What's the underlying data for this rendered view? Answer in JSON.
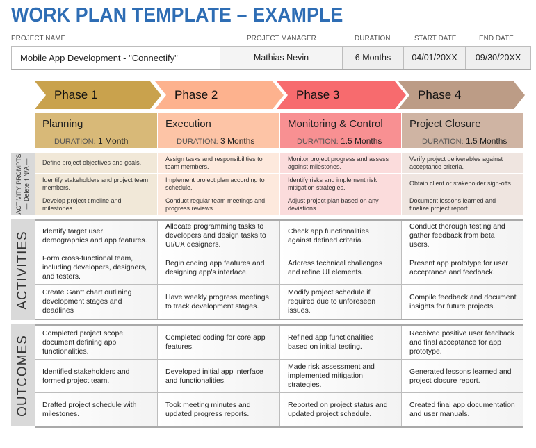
{
  "title": "WORK PLAN TEMPLATE – EXAMPLE",
  "project": {
    "labels": {
      "name": "PROJECT NAME",
      "manager": "PROJECT MANAGER",
      "duration": "DURATION",
      "start": "START DATE",
      "end": "END DATE"
    },
    "name": "Mobile App Development - \"Connectify\"",
    "manager": "Mathias Nevin",
    "duration": "6 Months",
    "start": "04/01/20XX",
    "end": "09/30/20XX"
  },
  "phases": [
    {
      "label": "Phase 1",
      "name": "Planning",
      "duration": "1 Month",
      "chevron_color": "#C9A24D",
      "box_color": "#D8B978"
    },
    {
      "label": "Phase 2",
      "name": "Execution",
      "duration": "3 Months",
      "chevron_color": "#FDB28E",
      "box_color": "#FDC4A6"
    },
    {
      "label": "Phase 3",
      "name": "Monitoring & Control",
      "duration": "1.5 Months",
      "chevron_color": "#F76B6E",
      "box_color": "#F89092"
    },
    {
      "label": "Phase 4",
      "name": "Project Closure",
      "duration": "1.5 Months",
      "chevron_color": "#BC9C86",
      "box_color": "#CFB4A3"
    }
  ],
  "duration_label": "DURATION:",
  "sections": {
    "prompts_label_line1": "ACTIVITY PROMPTS",
    "prompts_label_line2": "— Delete if N/A —",
    "activities_label": "ACTIVITIES",
    "outcomes_label": "OUTCOMES"
  },
  "prompts": [
    [
      "Define project objectives and goals.",
      "Assign tasks and responsibilities to team members.",
      "Monitor project progress and assess against milestones.",
      "Verify project deliverables against acceptance criteria."
    ],
    [
      "Identify stakeholders and project team members.",
      "Implement project plan according to schedule.",
      "Identify risks and implement risk mitigation strategies.",
      "Obtain client or stakeholder sign-offs."
    ],
    [
      "Develop project timeline and milestones.",
      "Conduct regular team meetings and progress reviews.",
      "Adjust project plan based on any deviations.",
      "Document lessons learned and finalize project report."
    ]
  ],
  "activities": [
    [
      "Identify target user demographics and app features.",
      "Allocate programming tasks to developers and design tasks to UI/UX designers.",
      "Check app functionalities against  defined criteria.",
      "Conduct thorough testing and gather feedback from beta users."
    ],
    [
      "Form cross-functional team, including developers, designers, and testers.",
      "Begin coding app features and designing app's interface.",
      "Address technical challenges and refine UI elements.",
      "Present app prototype for user acceptance and feedback."
    ],
    [
      "Create Gantt chart outlining development stages and deadlines",
      "Have weekly progress meetings to track development stages.",
      "Modify project schedule if required due to unforeseen issues.",
      "Compile feedback and document insights for future projects."
    ]
  ],
  "outcomes": [
    [
      "Completed project scope document defining app functionalities.",
      "Completed coding for core app features.",
      "Refined app functionalities based on initial testing.",
      "Received positive user feedback and final acceptance for app prototype."
    ],
    [
      "Identified stakeholders and formed project team.",
      "Developed initial app interface and functionalities.",
      "Made risk assessment and implemented mitigation strategies.",
      "Generated lessons learned and project closure report."
    ],
    [
      "Drafted project schedule with milestones.",
      "Took meeting minutes and updated progress reports.",
      "Reported on project status and updated project schedule.",
      "Created final app documentation and user manuals."
    ]
  ]
}
